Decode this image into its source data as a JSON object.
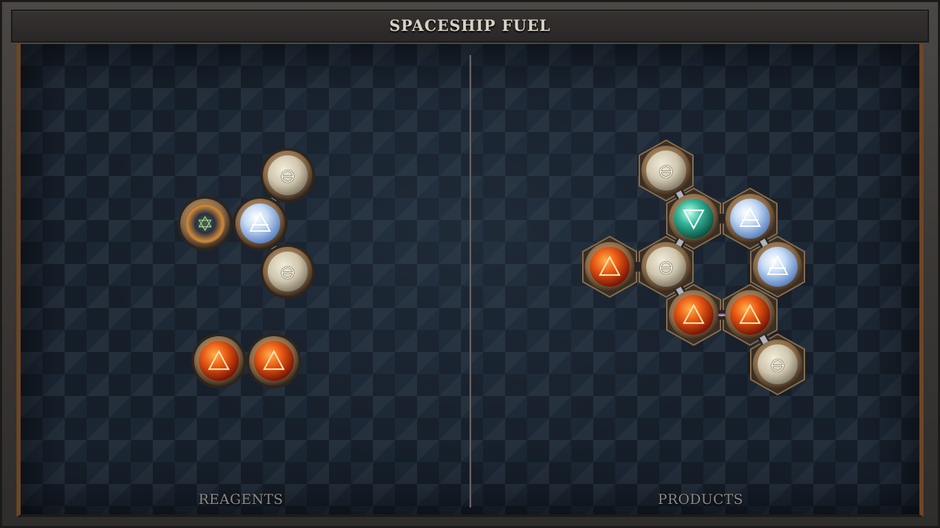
{
  "title": "SPACESHIP FUEL",
  "left_label": "REAGENTS",
  "right_label": "PRODUCTS",
  "colors": {
    "frame": "#3a3836",
    "board": "#1c2734",
    "accent_rail": "#6e4526",
    "title_text": "#d8d2c4",
    "label_text": "#8e8a84"
  },
  "reagents": {
    "molecules": [
      {
        "atoms": [
          {
            "element": "salt",
            "symbol": "⊖"
          },
          {
            "element": "quintessence",
            "symbol": "✡"
          },
          {
            "element": "air",
            "symbol": "🜁"
          },
          {
            "element": "salt",
            "symbol": "⊖"
          }
        ]
      },
      {
        "atoms": [
          {
            "element": "fire",
            "symbol": "△"
          },
          {
            "element": "fire",
            "symbol": "△"
          }
        ]
      }
    ]
  },
  "products": {
    "molecules": [
      {
        "atoms": [
          {
            "element": "salt",
            "symbol": "⊖"
          },
          {
            "element": "water",
            "symbol": "▽"
          },
          {
            "element": "air",
            "symbol": "🜁"
          },
          {
            "element": "fire",
            "symbol": "△"
          },
          {
            "element": "salt",
            "symbol": "⊖"
          },
          {
            "element": "air",
            "symbol": "🜁"
          },
          {
            "element": "fire",
            "symbol": "△"
          },
          {
            "element": "fire",
            "symbol": "△"
          },
          {
            "element": "salt",
            "symbol": "⊖"
          }
        ]
      }
    ]
  }
}
